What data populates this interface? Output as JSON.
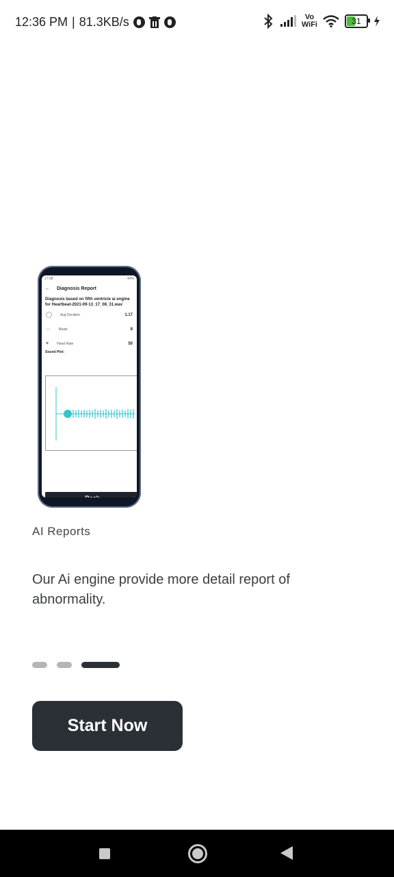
{
  "status_bar": {
    "time": "12:36 PM",
    "separator": "|",
    "net_speed": "81.3KB/s",
    "vowifi_top": "Vo",
    "vowifi_bottom": "WiFi",
    "battery": "31"
  },
  "phone_preview": {
    "status_time": "17:08",
    "status_battery": "44%",
    "header_title": "Diagnosis Report",
    "subtitle": "Diagnosis based on fifth ventricle ai engine for Heartbeat-2021-09-13_17_08_31.wav",
    "rows": [
      {
        "label": "Avg Duration",
        "value": "1.17"
      },
      {
        "label": "Beats",
        "value": "8"
      },
      {
        "label": "Heart Rate",
        "value": "50"
      }
    ],
    "sound_plot_label": "Sound Plot:",
    "back_label": "Back",
    "waveform_color": "#2ec8cc"
  },
  "onboarding": {
    "section_label": "AI Reports",
    "description": "Our Ai engine provide more detail report of abnormality.",
    "page_count": 3,
    "current_page": 3,
    "start_label": "Start Now"
  },
  "colors": {
    "primary": "#2b2f36",
    "dot_inactive": "#b3b5b8"
  }
}
